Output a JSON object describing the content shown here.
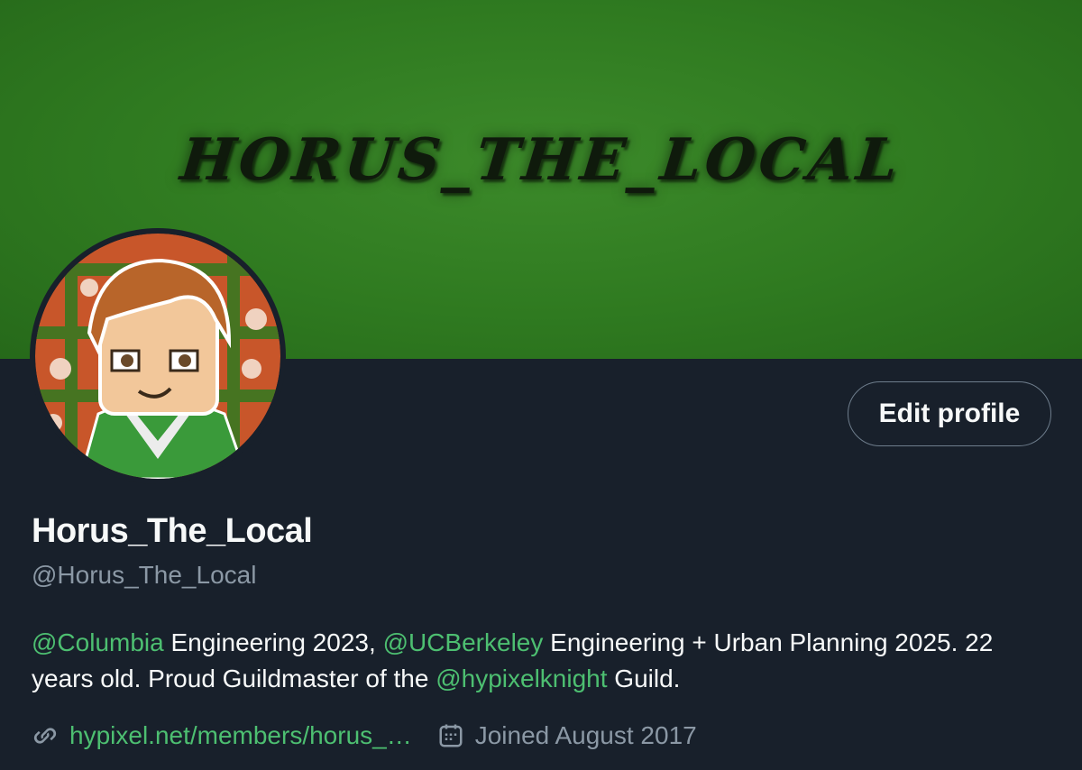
{
  "banner": {
    "text": "HORUS_THE_LOCAL",
    "background_color": "#2f7a20"
  },
  "header": {
    "edit_profile_label": "Edit profile"
  },
  "profile": {
    "display_name": "Horus_The_Local",
    "handle": "@Horus_The_Local",
    "bio": {
      "part1_mention": "@Columbia",
      "part2": " Engineering 2023, ",
      "part3_mention": "@UCBerkeley",
      "part4": " Engineering + Urban Planning 2025. 22 years old. Proud Guildmaster of the ",
      "part5_mention": "@hypixelknight",
      "part6": " Guild."
    },
    "website": "hypixel.net/members/horus_…",
    "joined": "Joined August 2017"
  },
  "icons": {
    "link": "link-icon",
    "calendar": "calendar-icon"
  },
  "colors": {
    "background": "#18202b",
    "accent": "#4dbf71",
    "text_primary": "#f7f9f9",
    "text_secondary": "#8b98a5"
  }
}
